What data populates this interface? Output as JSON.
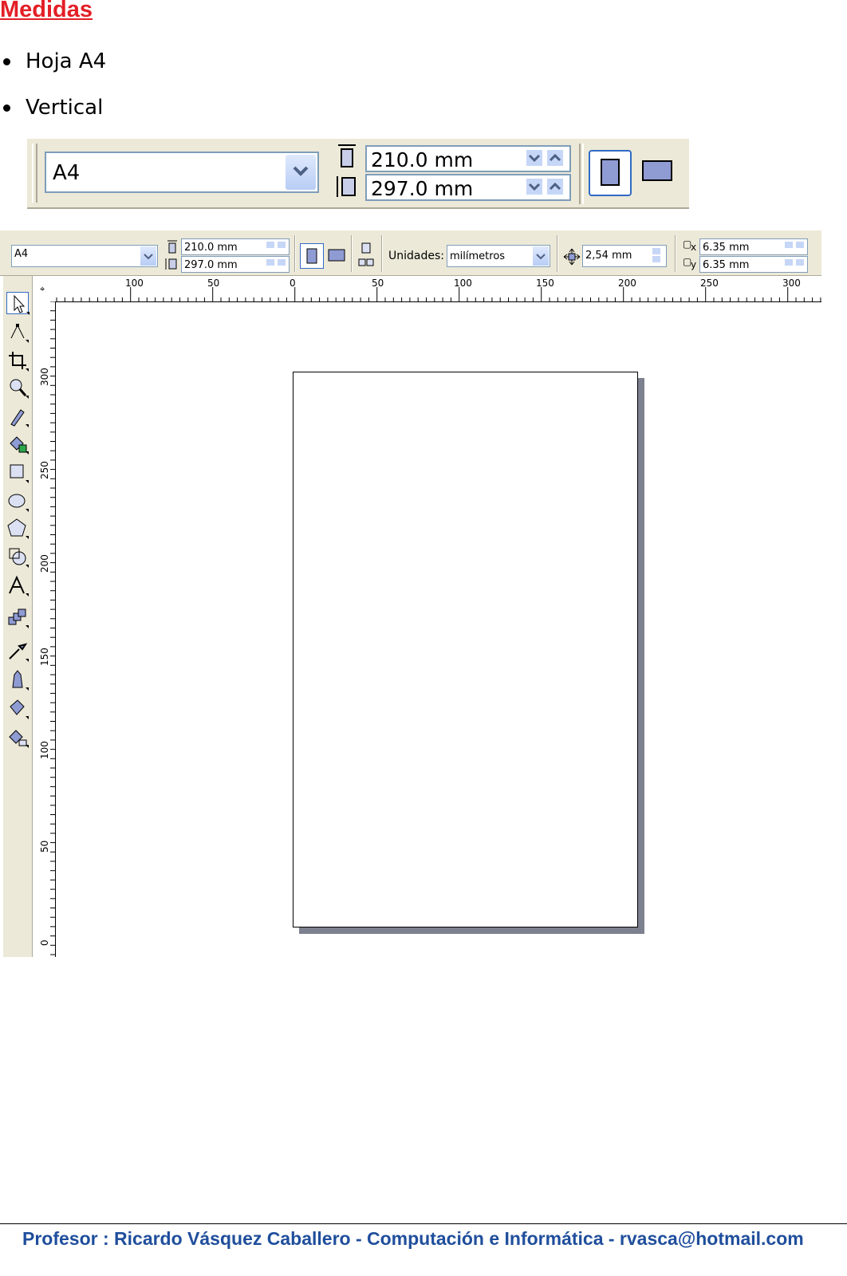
{
  "heading": "Medidas",
  "bullets": [
    "Hoja A4",
    "Vertical"
  ],
  "big_bar": {
    "paper": "A4",
    "width": "210.0 mm",
    "height": "297.0 mm"
  },
  "small_bar": {
    "paper": "A4",
    "width": "210.0 mm",
    "height": "297.0 mm",
    "units_label": "Unidades:",
    "units_value": "milímetros",
    "nudge": "2,54 mm",
    "dup_x": "6.35 mm",
    "dup_y": "6.35 mm",
    "dup_x_label": "x",
    "dup_y_label": "y"
  },
  "hruler_labels": [
    "100",
    "50",
    "0",
    "50",
    "100",
    "150",
    "200",
    "250",
    "300"
  ],
  "vruler_labels": [
    "300",
    "250",
    "200",
    "150",
    "100",
    "50",
    "0"
  ],
  "tools": [
    "pick-tool-icon",
    "shape-tool-icon",
    "crop-tool-icon",
    "zoom-tool-icon",
    "freehand-tool-icon",
    "smart-fill-tool-icon",
    "rectangle-tool-icon",
    "ellipse-tool-icon",
    "polygon-tool-icon",
    "basic-shapes-tool-icon",
    "text-tool-icon",
    "interactive-blend-tool-icon",
    "eyedropper-tool-icon",
    "outline-tool-icon",
    "fill-tool-icon",
    "interactive-fill-tool-icon"
  ],
  "footer": {
    "text": "Profesor : Ricardo Vásquez Caballero   -  Computación e Informática  -  rvasca@hotmail.com"
  }
}
